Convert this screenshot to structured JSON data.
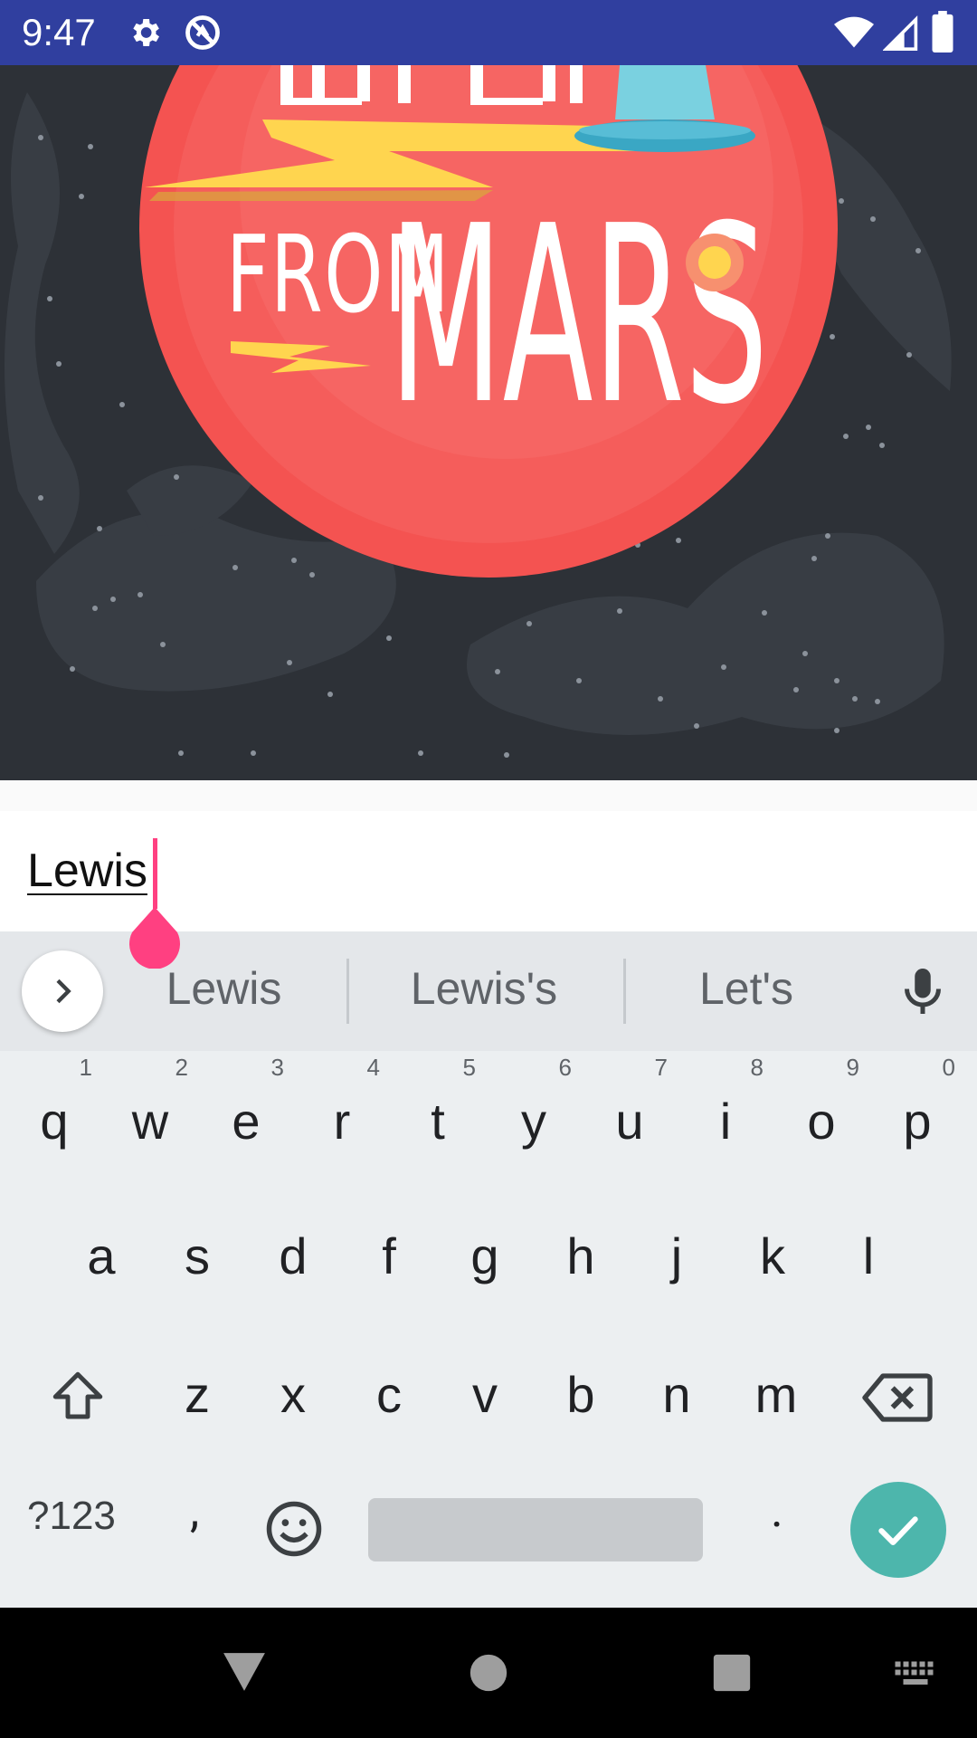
{
  "status_bar": {
    "time": "9:47",
    "icons": [
      "gear-icon",
      "do-not-disturb-icon",
      "wifi-icon",
      "cell-signal-icon",
      "battery-icon"
    ],
    "color": "#303f9f"
  },
  "hero": {
    "text_from": "FROM",
    "text_mars": "MARS"
  },
  "text_field": {
    "value": "Lewis",
    "cursor_color": "#ff4081"
  },
  "keyboard": {
    "suggestions": [
      "Lewis",
      "Lewis's",
      "Let's"
    ],
    "row1": [
      {
        "k": "q",
        "h": "1"
      },
      {
        "k": "w",
        "h": "2"
      },
      {
        "k": "e",
        "h": "3"
      },
      {
        "k": "r",
        "h": "4"
      },
      {
        "k": "t",
        "h": "5"
      },
      {
        "k": "y",
        "h": "6"
      },
      {
        "k": "u",
        "h": "7"
      },
      {
        "k": "i",
        "h": "8"
      },
      {
        "k": "o",
        "h": "9"
      },
      {
        "k": "p",
        "h": "0"
      }
    ],
    "row2": [
      "a",
      "s",
      "d",
      "f",
      "g",
      "h",
      "j",
      "k",
      "l"
    ],
    "row3": [
      "z",
      "x",
      "c",
      "v",
      "b",
      "n",
      "m"
    ],
    "symbols_label": "?123",
    "comma": ",",
    "period": ".",
    "accent_color": "#4db6ac"
  }
}
